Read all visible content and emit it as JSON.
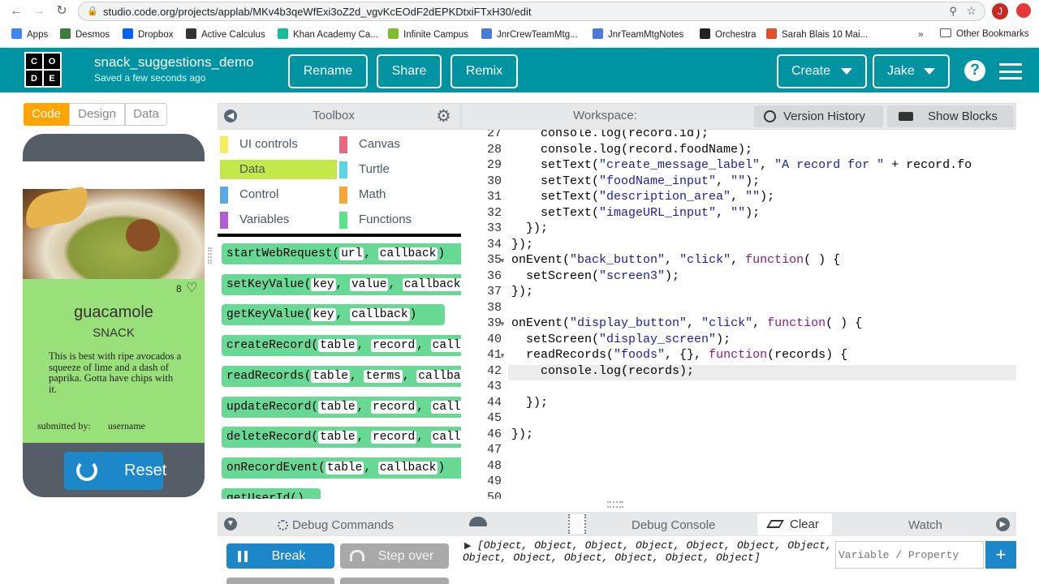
{
  "browser": {
    "url": "studio.code.org/projects/applab/MKv4b3qeWfExi3oZ2d_vgvKcEOdF2dEPKDtxiFTxH30/edit",
    "avatar_letter": "J",
    "bookmarks": [
      {
        "label": "Apps",
        "color": "#4285f4"
      },
      {
        "label": "Desmos",
        "color": "#3b7d3b"
      },
      {
        "label": "Dropbox",
        "color": "#0061fe"
      },
      {
        "label": "Active Calculus",
        "color": "#333333"
      },
      {
        "label": "Khan Academy Ca...",
        "color": "#14bf96"
      },
      {
        "label": "Infinite Campus",
        "color": "#7cbf2a"
      },
      {
        "label": "JnrCrewTeamMtg...",
        "color": "#4a7bd8"
      },
      {
        "label": "JnrTeamMtgNotes",
        "color": "#4a7bd8"
      },
      {
        "label": "Orchestra",
        "color": "#222222"
      },
      {
        "label": "Sarah Blais 10 Mai...",
        "color": "#e0502a"
      }
    ],
    "other_bookmarks": "Other Bookmarks"
  },
  "header": {
    "logo_letters": [
      "C",
      "O",
      "D",
      "E"
    ],
    "project_name": "snack_suggestions_demo",
    "saved": "Saved a few seconds ago",
    "rename": "Rename",
    "share": "Share",
    "remix": "Remix",
    "create": "Create",
    "user": "Jake"
  },
  "left": {
    "toggles": [
      "Code",
      "Design",
      "Data"
    ],
    "card": {
      "likes": "8",
      "title": "guacamole",
      "category": "SNACK",
      "description": "This is best with ripe avocados a squeeze of lime and a dash of paprika. Gotta have chips with it.",
      "submitted_label": "submitted by:",
      "submitted_user": "username"
    },
    "reset": "Reset"
  },
  "toolbox": {
    "title": "Toolbox",
    "categories": [
      {
        "label": "UI controls",
        "color": "#f7ec59"
      },
      {
        "label": "Canvas",
        "color": "#e86a7e"
      },
      {
        "label": "Data",
        "color": "#c4e84a"
      },
      {
        "label": "Turtle",
        "color": "#5ed3e3"
      },
      {
        "label": "Control",
        "color": "#5ba8e6"
      },
      {
        "label": "Math",
        "color": "#f5a73b"
      },
      {
        "label": "Variables",
        "color": "#b25dd6"
      },
      {
        "label": "Functions",
        "color": "#5fe08a"
      }
    ],
    "blocks": [
      {
        "name": "startWebRequest",
        "params": [
          "url",
          "callback"
        ]
      },
      {
        "name": "setKeyValue",
        "params": [
          "key",
          "value",
          "callback"
        ]
      },
      {
        "name": "getKeyValue",
        "params": [
          "key",
          "callback"
        ]
      },
      {
        "name": "createRecord",
        "params": [
          "table",
          "record",
          "callback"
        ]
      },
      {
        "name": "readRecords",
        "params": [
          "table",
          "terms",
          "callback"
        ]
      },
      {
        "name": "updateRecord",
        "params": [
          "table",
          "record",
          "callback"
        ]
      },
      {
        "name": "deleteRecord",
        "params": [
          "table",
          "record",
          "callback"
        ]
      },
      {
        "name": "onRecordEvent",
        "params": [
          "table",
          "callback"
        ]
      },
      {
        "name": "getUserId",
        "params": []
      }
    ]
  },
  "workspace": {
    "title": "Workspace:",
    "version_history": "Version History",
    "show_blocks": "Show Blocks",
    "lines": [
      {
        "n": "27",
        "code": "    console.log(record.id);"
      },
      {
        "n": "28",
        "code": "    console.log(record.foodName);"
      },
      {
        "n": "29",
        "code": "    setText(\"create_message_label\", \"A record for \" + record.fo"
      },
      {
        "n": "30",
        "code": "    setText(\"foodName_input\", \"\");"
      },
      {
        "n": "31",
        "code": "    setText(\"description_area\", \"\");"
      },
      {
        "n": "32",
        "code": "    setText(\"imageURL_input\", \"\");"
      },
      {
        "n": "33",
        "code": "  });"
      },
      {
        "n": "34",
        "code": "});"
      },
      {
        "n": "35",
        "code": "onEvent(\"back_button\", \"click\", function( ) {"
      },
      {
        "n": "36",
        "code": "  setScreen(\"screen3\");"
      },
      {
        "n": "37",
        "code": "});"
      },
      {
        "n": "38",
        "code": ""
      },
      {
        "n": "39",
        "code": "onEvent(\"display_button\", \"click\", function( ) {"
      },
      {
        "n": "40",
        "code": "  setScreen(\"display_screen\");"
      },
      {
        "n": "41",
        "code": "  readRecords(\"foods\", {}, function(records) {"
      },
      {
        "n": "42",
        "code": "    console.log(records);"
      },
      {
        "n": "43",
        "code": ""
      },
      {
        "n": "44",
        "code": "  });"
      },
      {
        "n": "45",
        "code": ""
      },
      {
        "n": "46",
        "code": "});"
      },
      {
        "n": "47",
        "code": ""
      },
      {
        "n": "48",
        "code": ""
      },
      {
        "n": "49",
        "code": ""
      },
      {
        "n": "50",
        "code": ""
      }
    ],
    "fold_lines": [
      "35",
      "39",
      "41"
    ]
  },
  "debug": {
    "commands_title": "Debug Commands",
    "break": "Break",
    "step_over": "Step over",
    "console_title": "Debug Console",
    "clear": "Clear",
    "console_output": "[Object, Object, Object, Object, Object, Object, Object, Object, Object, Object, Object, Object, Object]",
    "watch_title": "Watch",
    "watch_placeholder": "Variable / Property"
  },
  "colors": {
    "teal": "#0094a3",
    "orange": "#ffa400",
    "block_green": "#68d995",
    "card_green": "#99e07a",
    "debug_blue": "#1c87c9",
    "grey_btn": "#a9a9a9"
  }
}
